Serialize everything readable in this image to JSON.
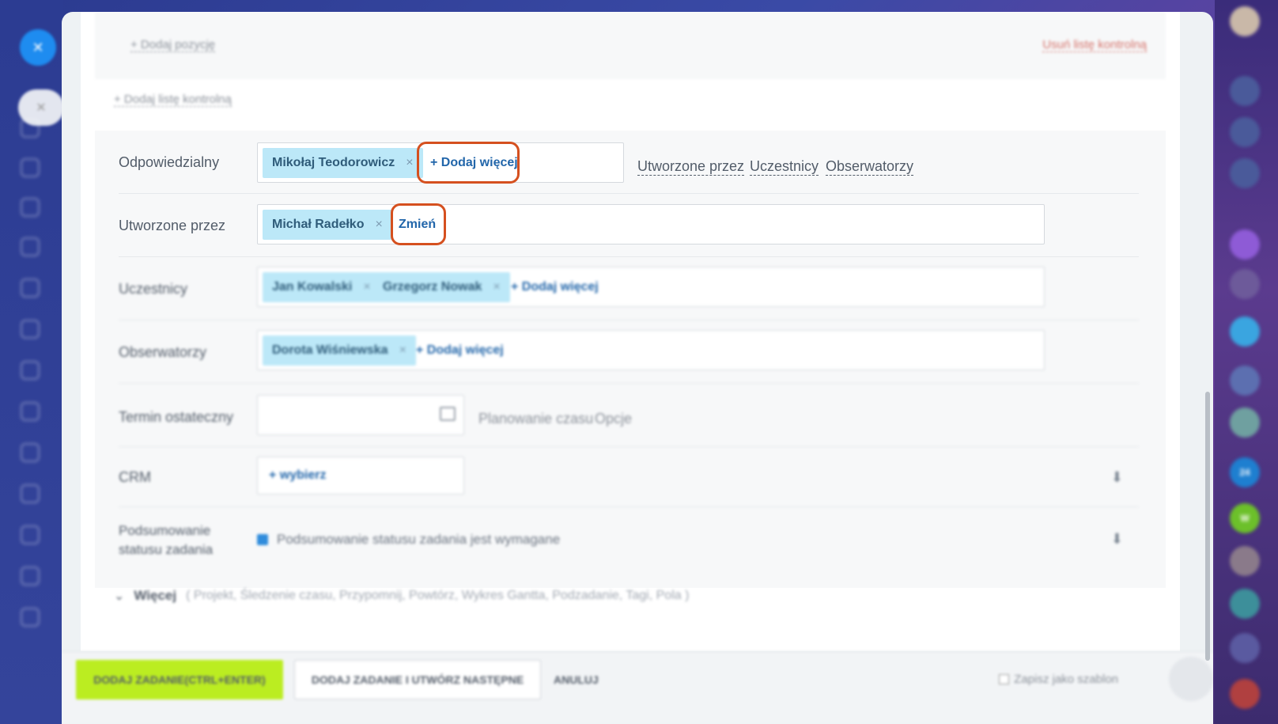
{
  "checklist": {
    "add_position": "+ Dodaj pozycję",
    "remove_checklist": "Usuń listę kontrolną",
    "add_checklist": "+ Dodaj listę kontrolną"
  },
  "responsible": {
    "label": "Odpowiedzialny",
    "chip": "Mikołaj Teodorowicz",
    "add_more": "+ Dodaj więcej",
    "side_links": [
      "Utworzone przez",
      "Uczestnicy",
      "Obserwatorzy"
    ]
  },
  "created_by": {
    "label": "Utworzone przez",
    "chip": "Michał Radełko",
    "change": "Zmień"
  },
  "participants": {
    "label": "Uczestnicy",
    "chips": [
      "Jan Kowalski",
      "Grzegorz Nowak"
    ],
    "add_more": "+ Dodaj więcej"
  },
  "observers": {
    "label": "Obserwatorzy",
    "chip": "Dorota Wiśniewska",
    "add_more": "+ Dodaj więcej"
  },
  "deadline": {
    "label": "Termin ostateczny",
    "time_planning": "Planowanie czasu",
    "options": "Opcje"
  },
  "crm": {
    "label": "CRM",
    "select": "+ wybierz"
  },
  "summary": {
    "label_line1": "Podsumowanie",
    "label_line2": "statusu zadania",
    "checkbox_label": "Podsumowanie statusu zadania jest wymagane"
  },
  "more": {
    "label": "Więcej",
    "items": "( Projekt,  Śledzenie czasu,  Przypomnij,  Powtórz,  Wykres Gantta,  Podzadanie,  Tagi,  Pola )"
  },
  "footer": {
    "add_task": "DODAJ ZADANIE(CTRL+ENTER)",
    "add_and_next": "DODAJ ZADANIE I UTWÓRZ NASTĘPNE",
    "cancel": "ANULUJ",
    "save_template": "Zapisz jako szablon"
  },
  "colors": {
    "accent_highlight": "#d5501f",
    "primary_button": "#bbed21",
    "chip_bg": "#bce8f8",
    "link_blue": "#2266aa"
  },
  "icons": {
    "close": "close-icon",
    "calendar": "calendar-icon",
    "pin": "pin-icon",
    "chevron": "chevron-down-icon"
  }
}
